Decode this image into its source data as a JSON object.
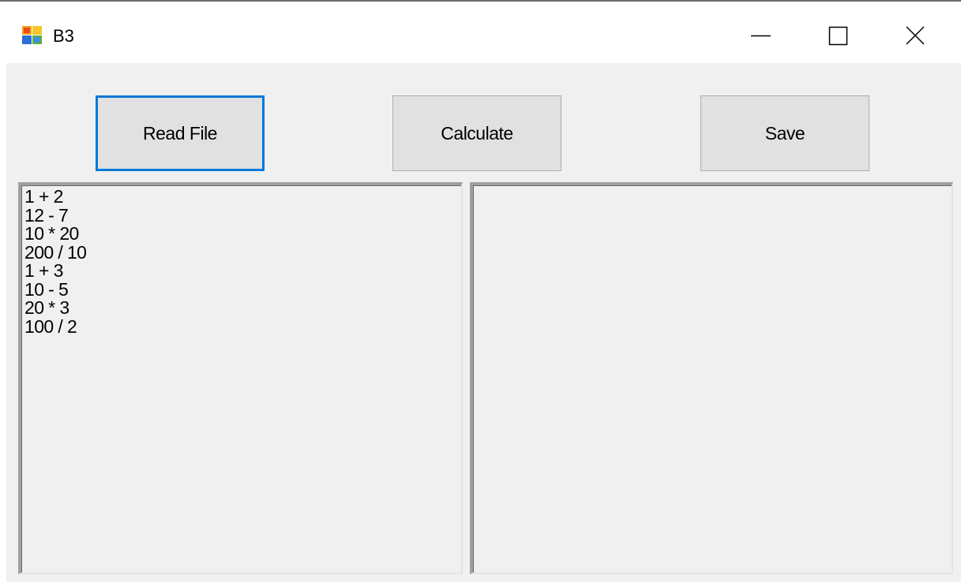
{
  "window": {
    "title": "B3",
    "icon": "winforms-app-icon",
    "controls": {
      "minimize": "minimize-icon",
      "maximize": "maximize-icon",
      "close": "close-icon"
    }
  },
  "toolbar": {
    "read_label": "Read File",
    "calculate_label": "Calculate",
    "save_label": "Save"
  },
  "input_box": {
    "lines": [
      "1 + 2",
      "12 - 7",
      "10 * 20",
      "200 / 10",
      "1 + 3",
      "10 - 5",
      "20 * 3",
      "100 / 2"
    ]
  },
  "output_box": {
    "lines": []
  },
  "colors": {
    "focus_border": "#0078d7",
    "button_face": "#e1e1e1",
    "form_background": "#f0f0f0"
  }
}
